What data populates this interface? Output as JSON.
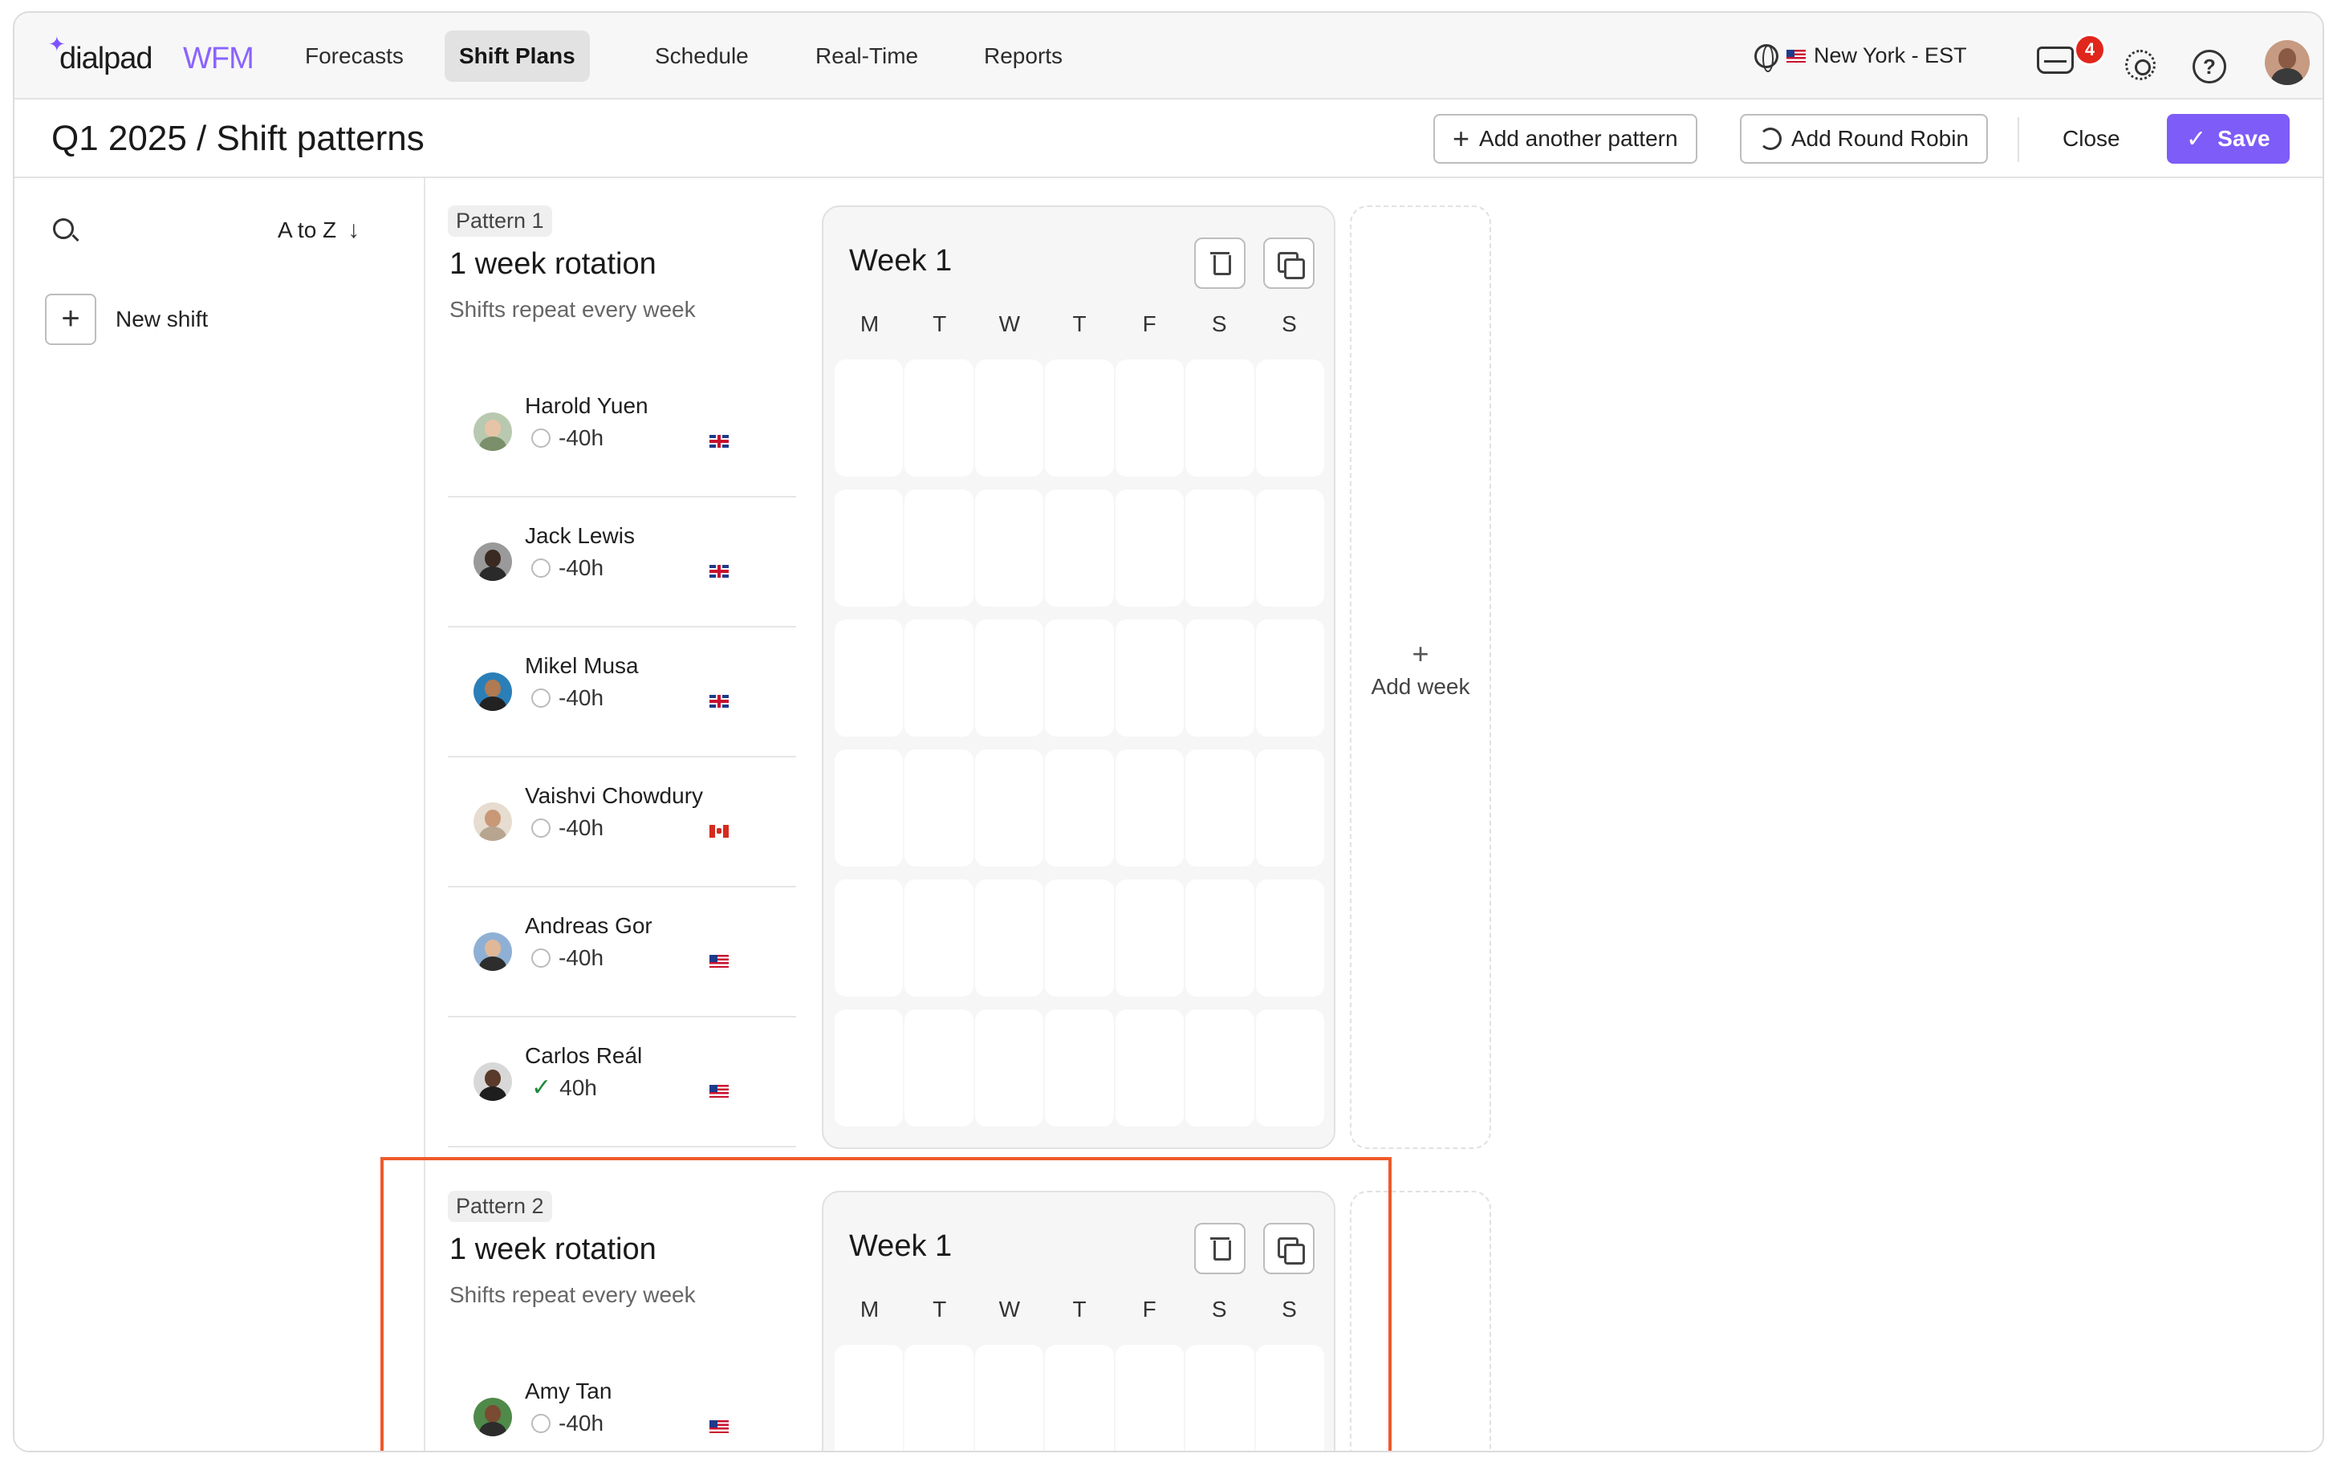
{
  "app": {
    "logo_text": "dialpad",
    "logo_suffix": "WFM",
    "accent_color": "#8a63ff"
  },
  "nav": {
    "tabs": [
      {
        "label": "Forecasts",
        "active": false
      },
      {
        "label": "Shift Plans",
        "active": true
      },
      {
        "label": "Schedule",
        "active": false
      },
      {
        "label": "Real-Time",
        "active": false
      },
      {
        "label": "Reports",
        "active": false
      }
    ],
    "timezone": "New York - EST",
    "notifications_count": "4"
  },
  "page": {
    "title": "Q1 2025 / Shift patterns",
    "add_pattern_label": "Add another pattern",
    "add_round_robin_label": "Add Round Robin",
    "close_label": "Close",
    "save_label": "Save",
    "primary_color": "#7e5cf7"
  },
  "sidebar": {
    "sort_label": "A to Z",
    "new_shift_label": "New shift"
  },
  "days": [
    "M",
    "T",
    "W",
    "T",
    "F",
    "S",
    "S"
  ],
  "add_week_label": "Add week",
  "patterns": [
    {
      "label": "Pattern 1",
      "title": "1 week rotation",
      "subtitle": "Shifts repeat every week",
      "week_title": "Week 1",
      "agents": [
        {
          "name": "Harold Yuen",
          "hours": "-40h",
          "status": "incomplete",
          "flag": "uk"
        },
        {
          "name": "Jack Lewis",
          "hours": "-40h",
          "status": "incomplete",
          "flag": "uk"
        },
        {
          "name": "Mikel Musa",
          "hours": "-40h",
          "status": "incomplete",
          "flag": "uk"
        },
        {
          "name": "Vaishvi Chowdury",
          "hours": "-40h",
          "status": "incomplete",
          "flag": "ca"
        },
        {
          "name": "Andreas Gor",
          "hours": "-40h",
          "status": "incomplete",
          "flag": "us"
        },
        {
          "name": "Carlos Reál",
          "hours": "40h",
          "status": "complete",
          "flag": "us"
        }
      ]
    },
    {
      "label": "Pattern 2",
      "title": "1 week rotation",
      "subtitle": "Shifts repeat every week",
      "week_title": "Week 1",
      "agents": [
        {
          "name": "Amy Tan",
          "hours": "-40h",
          "status": "incomplete",
          "flag": "us"
        }
      ]
    }
  ],
  "highlight_color": "#ef5a2a"
}
